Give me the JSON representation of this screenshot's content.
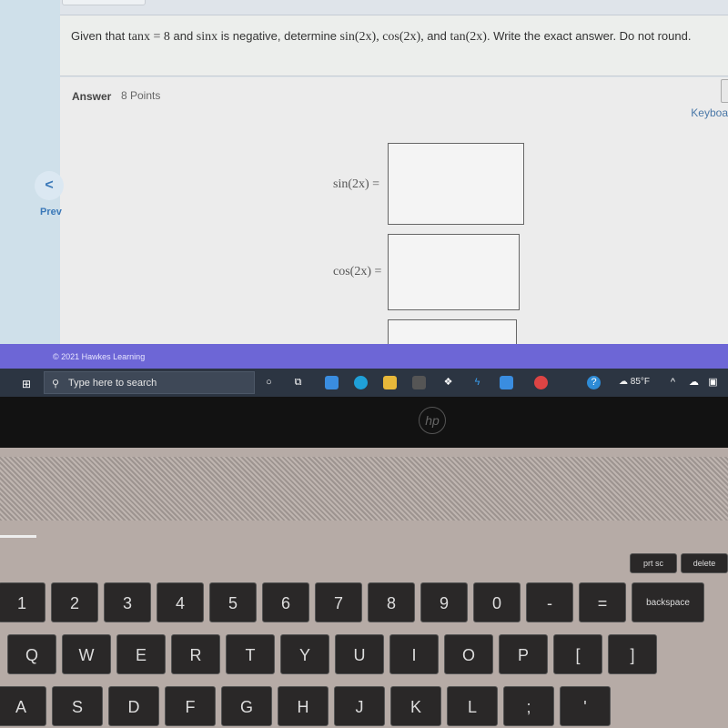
{
  "question": {
    "text_prefix": "Given that ",
    "tan_expr": "tanx = 8",
    "text_mid1": " and ",
    "sin_expr": "sinx",
    "text_mid2": " is negative, determine ",
    "targets": "sin(2x), cos(2x), ",
    "text_mid3": "and ",
    "tan_target": "tan(2x)",
    "text_suffix": ". Write the exact answer. Do not round."
  },
  "answer": {
    "label": "Answer",
    "points": "8 Points",
    "keyboard_label": "Keyboa",
    "fields": [
      {
        "label": "sin(2x) =",
        "value": ""
      },
      {
        "label": "cos(2x) =",
        "value": ""
      }
    ]
  },
  "nav": {
    "prev_label": "Prev",
    "prev_icon": "chevron-left-icon",
    "prev_glyph": "<"
  },
  "footer": {
    "copyright": "© 2021 Hawkes Learning"
  },
  "taskbar": {
    "search_placeholder": "Type here to search",
    "weather": "85°F",
    "colors": {
      "footer": "#6d66d6",
      "taskbar": "#2c3542"
    }
  },
  "laptop": {
    "logo": "hp",
    "fn_keys": [
      "prt sc",
      "delete"
    ],
    "number_row": [
      "1",
      "2",
      "3",
      "4",
      "5",
      "6",
      "7",
      "8",
      "9",
      "0",
      "-",
      "=",
      "backspace"
    ],
    "qwerty_row": [
      "Q",
      "W",
      "E",
      "R",
      "T",
      "Y",
      "U",
      "I",
      "O",
      "P",
      "[",
      "]"
    ],
    "home_row": [
      "A",
      "S",
      "D",
      "F",
      "G",
      "H",
      "J",
      "K",
      "L",
      ";",
      "'"
    ]
  }
}
